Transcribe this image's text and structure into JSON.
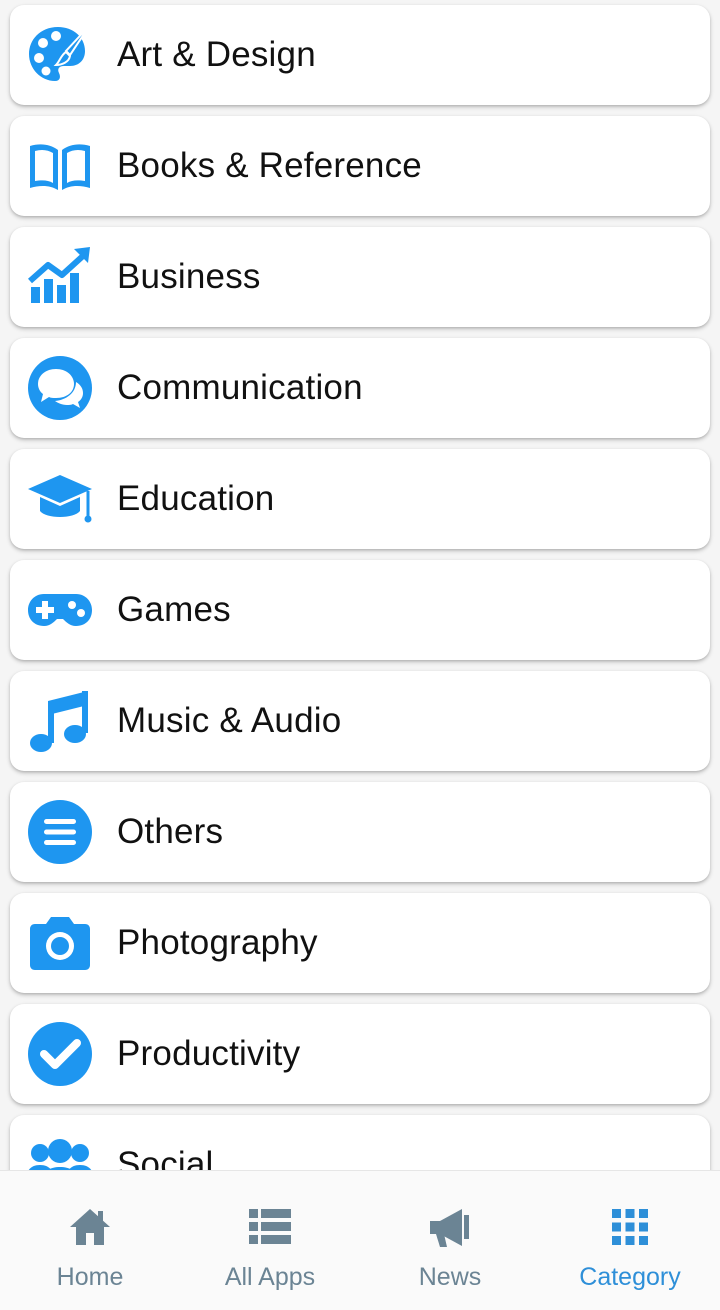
{
  "categories": [
    {
      "label": "Art & Design",
      "icon": "palette-icon"
    },
    {
      "label": "Books & Reference",
      "icon": "book-icon"
    },
    {
      "label": "Business",
      "icon": "chart-growth-icon"
    },
    {
      "label": "Communication",
      "icon": "chat-bubbles-icon"
    },
    {
      "label": "Education",
      "icon": "graduation-cap-icon"
    },
    {
      "label": "Games",
      "icon": "gamepad-icon"
    },
    {
      "label": "Music & Audio",
      "icon": "music-note-icon"
    },
    {
      "label": "Others",
      "icon": "menu-circle-icon"
    },
    {
      "label": "Photography",
      "icon": "camera-icon"
    },
    {
      "label": "Productivity",
      "icon": "check-circle-icon"
    },
    {
      "label": "Social",
      "icon": "users-icon"
    }
  ],
  "bottom_nav": {
    "items": [
      {
        "label": "Home",
        "icon": "home-icon"
      },
      {
        "label": "All Apps",
        "icon": "list-icon"
      },
      {
        "label": "News",
        "icon": "megaphone-icon"
      },
      {
        "label": "Category",
        "icon": "grid-icon"
      }
    ],
    "active": "Category"
  },
  "colors": {
    "accent": "#1e96f0",
    "nav_inactive": "#6b8494",
    "nav_active": "#2e8fd8",
    "card_bg": "#ffffff",
    "page_bg": "#f5f5f5"
  }
}
